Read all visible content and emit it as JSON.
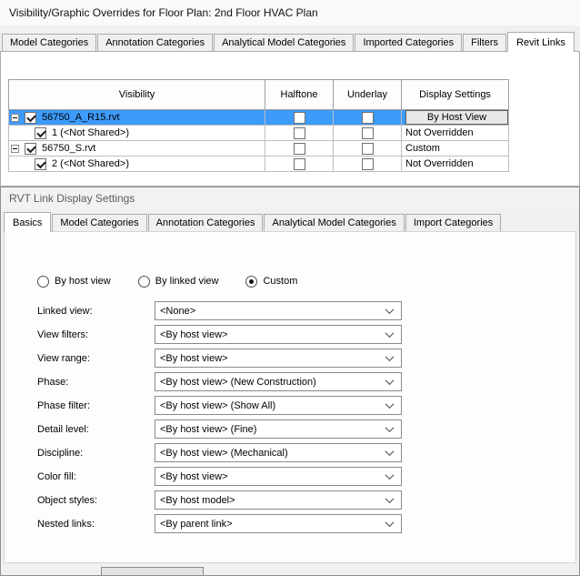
{
  "colors": {
    "selection": "#3d9bfc"
  },
  "window": {
    "title": "Visibility/Graphic Overrides for Floor Plan: 2nd Floor HVAC Plan"
  },
  "main_tabs": [
    {
      "id": "model-categories",
      "label": "Model Categories",
      "active": false
    },
    {
      "id": "annotation-categories",
      "label": "Annotation Categories",
      "active": false
    },
    {
      "id": "analytical-model-categories",
      "label": "Analytical Model Categories",
      "active": false
    },
    {
      "id": "imported-categories",
      "label": "Imported Categories",
      "active": false
    },
    {
      "id": "filters",
      "label": "Filters",
      "active": false
    },
    {
      "id": "revit-links",
      "label": "Revit Links",
      "active": true
    }
  ],
  "link_table": {
    "columns": [
      "Visibility",
      "Halftone",
      "Underlay",
      "Display Settings"
    ],
    "rows": [
      {
        "id": "56750-a-r15",
        "label": "56750_A_R15.rvt",
        "indent": 0,
        "expander": "minus",
        "checked": true,
        "halftone": false,
        "underlay": false,
        "display": "By Host View",
        "display_kind": "button",
        "selected": true
      },
      {
        "id": "instance-1",
        "label": "1 (<Not Shared>)",
        "indent": 1,
        "expander": null,
        "checked": true,
        "halftone": false,
        "underlay": false,
        "display": "Not Overridden",
        "display_kind": "text",
        "selected": false
      },
      {
        "id": "56750-s",
        "label": "56750_S.rvt",
        "indent": 0,
        "expander": "minus",
        "checked": true,
        "halftone": false,
        "underlay": false,
        "display": "Custom",
        "display_kind": "text",
        "selected": false
      },
      {
        "id": "instance-2",
        "label": "2 (<Not Shared>)",
        "indent": 1,
        "expander": null,
        "checked": true,
        "halftone": false,
        "underlay": false,
        "display": "Not Overridden",
        "display_kind": "text",
        "selected": false
      }
    ]
  },
  "rvt_dialog": {
    "title": "RVT Link Display Settings",
    "tabs": [
      {
        "id": "basics",
        "label": "Basics",
        "active": true
      },
      {
        "id": "model-categories",
        "label": "Model Categories",
        "active": false
      },
      {
        "id": "annotation-categories",
        "label": "Annotation Categories",
        "active": false
      },
      {
        "id": "analytical-model-categories",
        "label": "Analytical Model Categories",
        "active": false
      },
      {
        "id": "import-categories",
        "label": "Import Categories",
        "active": false
      }
    ],
    "radios": [
      {
        "id": "by-host-view",
        "label": "By host view",
        "selected": false
      },
      {
        "id": "by-linked-view",
        "label": "By linked view",
        "selected": false
      },
      {
        "id": "custom",
        "label": "Custom",
        "selected": true
      }
    ],
    "fields": [
      {
        "id": "linked-view",
        "label": "Linked view:",
        "value": "<None>"
      },
      {
        "id": "view-filters",
        "label": "View filters:",
        "value": "<By host view>"
      },
      {
        "id": "view-range",
        "label": "View range:",
        "value": "<By host view>"
      },
      {
        "id": "phase",
        "label": "Phase:",
        "value": "<By host view> (New Construction)"
      },
      {
        "id": "phase-filter",
        "label": "Phase filter:",
        "value": "<By host view> (Show All)"
      },
      {
        "id": "detail-level",
        "label": "Detail level:",
        "value": "<By host view> (Fine)"
      },
      {
        "id": "discipline",
        "label": "Discipline:",
        "value": "<By host view> (Mechanical)"
      },
      {
        "id": "color-fill",
        "label": "Color fill:",
        "value": "<By host view>"
      },
      {
        "id": "object-styles",
        "label": "Object styles:",
        "value": "<By host model>"
      },
      {
        "id": "nested-links",
        "label": "Nested links:",
        "value": "<By parent link>"
      }
    ]
  }
}
